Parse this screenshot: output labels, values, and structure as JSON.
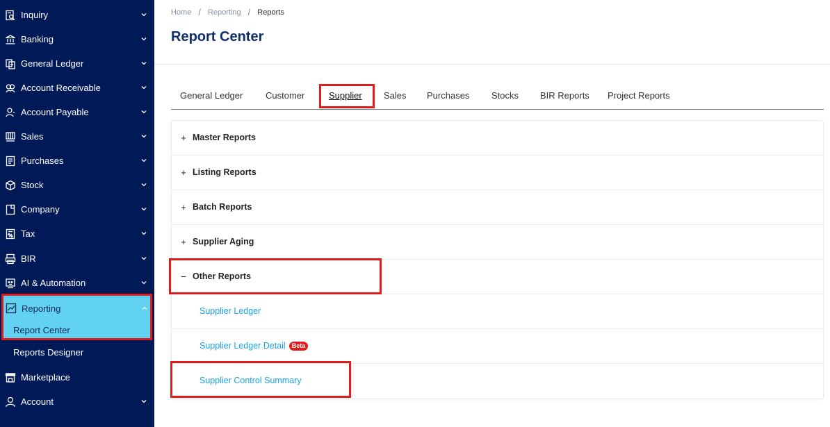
{
  "sidebar": {
    "items": [
      {
        "label": "Inquiry",
        "icon": "inquiry-icon"
      },
      {
        "label": "Banking",
        "icon": "bank-icon"
      },
      {
        "label": "General Ledger",
        "icon": "ledger-icon"
      },
      {
        "label": "Account Receivable",
        "icon": "receivable-icon"
      },
      {
        "label": "Account Payable",
        "icon": "payable-icon"
      },
      {
        "label": "Sales",
        "icon": "sales-icon"
      },
      {
        "label": "Purchases",
        "icon": "purchases-icon"
      },
      {
        "label": "Stock",
        "icon": "stock-icon"
      },
      {
        "label": "Company",
        "icon": "company-icon"
      },
      {
        "label": "Tax",
        "icon": "tax-icon"
      },
      {
        "label": "BIR",
        "icon": "bir-icon"
      },
      {
        "label": "AI & Automation",
        "icon": "ai-icon"
      }
    ],
    "reporting": {
      "label": "Reporting",
      "icon": "chart-icon",
      "sub_items": [
        "Report Center",
        "Reports Designer"
      ]
    },
    "bottom_items": [
      {
        "label": "Marketplace",
        "icon": "store-icon"
      },
      {
        "label": "Account",
        "icon": "user-icon"
      }
    ]
  },
  "breadcrumb": [
    "Home",
    "Reporting",
    "Reports"
  ],
  "page_title": "Report Center",
  "tabs": [
    "General Ledger",
    "Customer",
    "Supplier",
    "Sales",
    "Purchases",
    "Stocks",
    "BIR Reports",
    "Project Reports"
  ],
  "active_tab": "Supplier",
  "sections": [
    {
      "label": "Master Reports",
      "toggle": "+"
    },
    {
      "label": "Listing Reports",
      "toggle": "+"
    },
    {
      "label": "Batch Reports",
      "toggle": "+"
    },
    {
      "label": "Supplier Aging",
      "toggle": "+"
    },
    {
      "label": "Other Reports",
      "toggle": "−"
    }
  ],
  "other_reports": [
    {
      "label": "Supplier Ledger"
    },
    {
      "label": "Supplier Ledger Detail",
      "badge": "Beta"
    },
    {
      "label": "Supplier Control Summary"
    }
  ],
  "colors": {
    "sidebar_bg": "#001a57",
    "active_bg": "#62d2f2",
    "highlight": "#e21b1b",
    "link": "#1aa3e8",
    "title": "#0f2e6e"
  }
}
